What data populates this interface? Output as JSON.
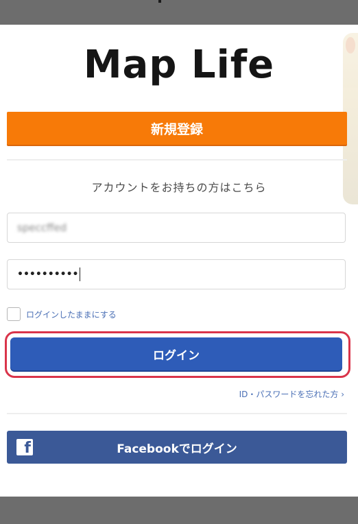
{
  "app": {
    "title": "Map Life"
  },
  "register": {
    "label": "新規登録"
  },
  "account": {
    "prompt": "アカウントをお持ちの方はこちら"
  },
  "login_form": {
    "id_value": "speccffed",
    "password_mask": "••••••••••",
    "remember_label": "ログインしたままにする",
    "remember_checked": false,
    "login_label": "ログイン",
    "forgot_label": "ID・パスワードを忘れた方 ›"
  },
  "facebook": {
    "label": "Facebookでログイン",
    "icon_letter": "f"
  },
  "colors": {
    "register": "#f77a08",
    "login": "#2e5cb8",
    "facebook": "#3b5997",
    "highlight": "#d9344a",
    "link": "#4a6fb5"
  }
}
